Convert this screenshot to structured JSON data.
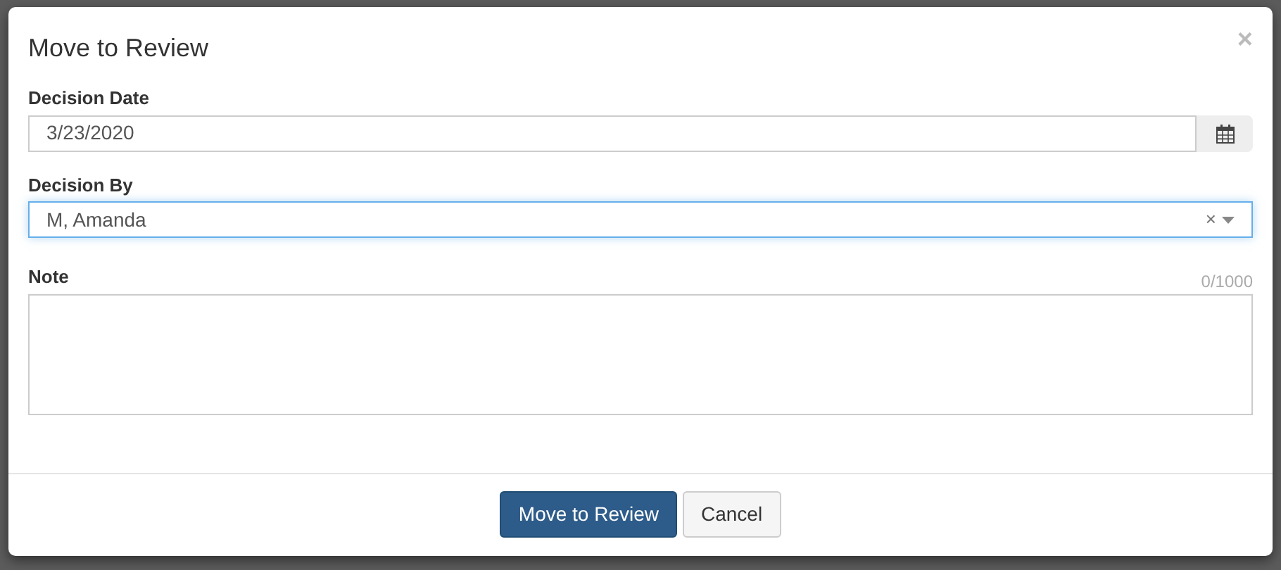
{
  "dialog": {
    "title": "Move to Review",
    "close_glyph": "×"
  },
  "fields": [
    {
      "kind": "date",
      "label": "Decision Date",
      "value": "3/23/2020"
    },
    {
      "kind": "select",
      "label": "Decision By",
      "value": "M, Amanda",
      "focused": true,
      "clear_glyph": "×"
    },
    {
      "kind": "textarea",
      "label": "Note",
      "counter": "0/1000"
    }
  ],
  "buttons": [
    {
      "label": "Move to Review",
      "kind": "primary"
    },
    {
      "label": "Cancel",
      "kind": "secondary"
    }
  ]
}
